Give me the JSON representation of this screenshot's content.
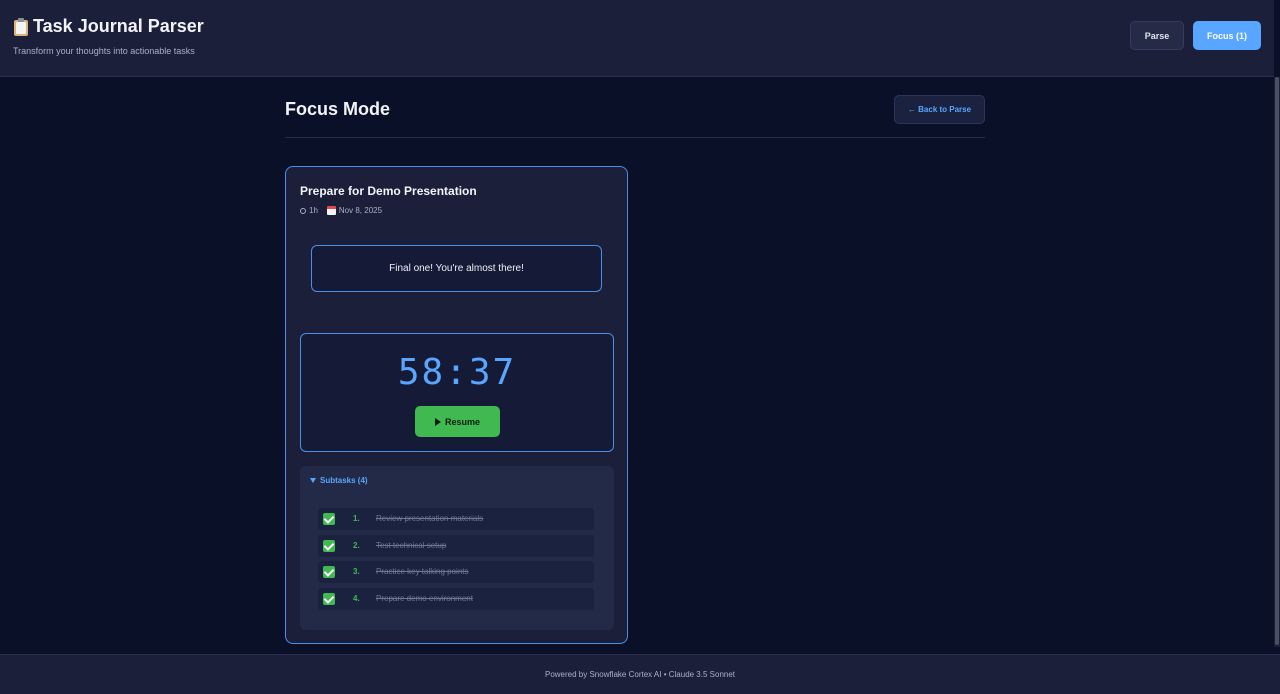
{
  "header": {
    "title": "Task Journal Parser",
    "subtitle": "Transform your thoughts into actionable tasks",
    "parse_label": "Parse",
    "focus_label": "Focus (1)"
  },
  "main": {
    "page_title": "Focus Mode",
    "back_label": "← Back to Parse"
  },
  "task": {
    "title": "Prepare for Demo Presentation",
    "duration": "1h",
    "date": "Nov 8, 2025",
    "message": "Final one! You're almost there!",
    "timer": "58:37",
    "resume_label": "Resume",
    "subtasks_label": "Subtasks (4)",
    "subtasks": [
      {
        "num": "1.",
        "text": "Review presentation materials",
        "done": true
      },
      {
        "num": "2.",
        "text": "Test technical setup",
        "done": true
      },
      {
        "num": "3.",
        "text": "Practice key talking points",
        "done": true
      },
      {
        "num": "4.",
        "text": "Prepare demo environment",
        "done": true
      }
    ]
  },
  "footer": {
    "text": "Powered by Snowflake Cortex AI • Claude 3.5 Sonnet"
  },
  "colors": {
    "accent": "#58a6ff",
    "success": "#3fb950",
    "background": "#0b1029",
    "panel": "#1b1f3a"
  }
}
